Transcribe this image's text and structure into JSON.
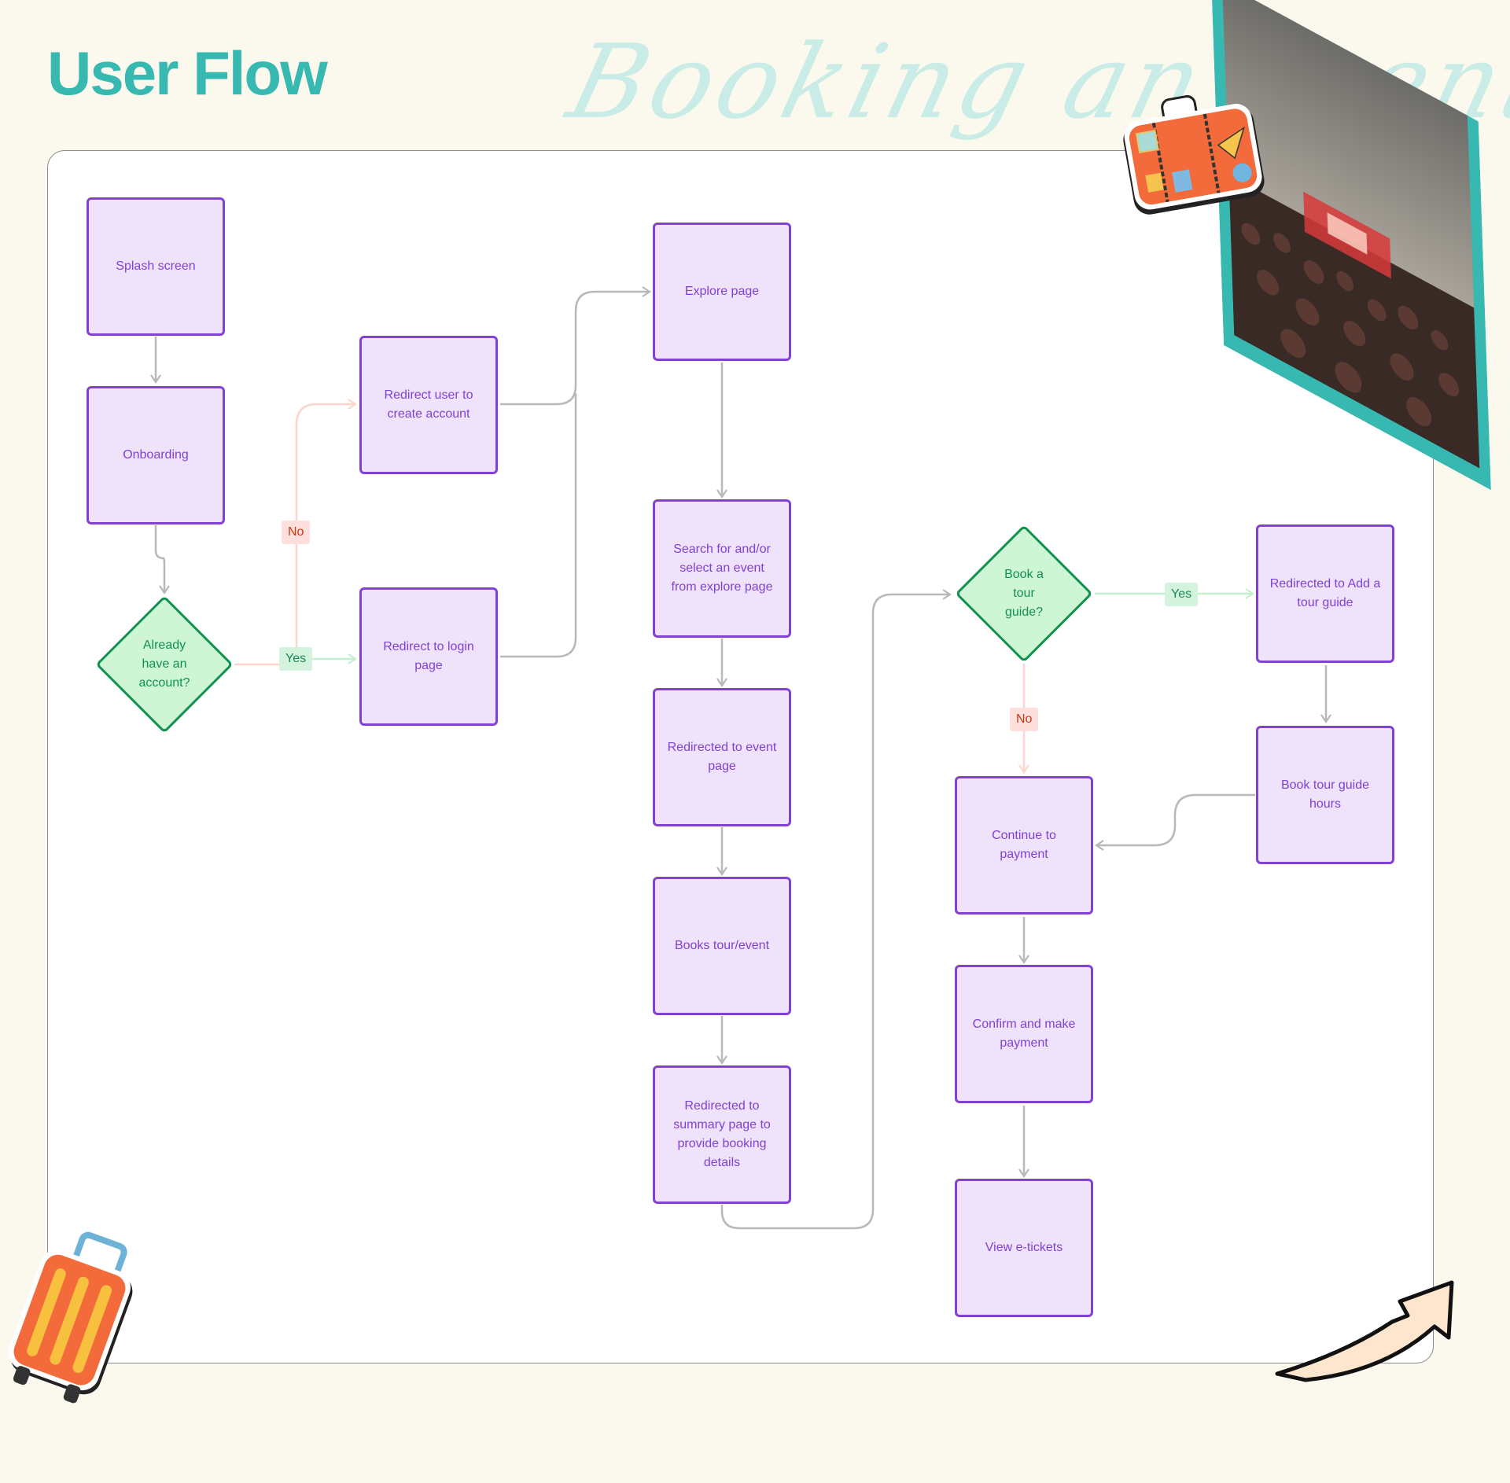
{
  "header": {
    "title": "User Flow",
    "script_subtitle": "Booking an event"
  },
  "colors": {
    "title": "#37b8b0",
    "process_fill": "#efe3fc",
    "process_border": "#8140d6",
    "decision_fill": "#cdf5d6",
    "decision_border": "#10924e",
    "connector": "#b8b8b8",
    "yes_badge": "#d3f3dc",
    "no_badge": "#fde0dc"
  },
  "nodes": {
    "splash": "Splash screen",
    "onboarding": "Onboarding",
    "create_account": "Redirect user to create account",
    "login": "Redirect to login page",
    "explore": "Explore page",
    "search": "Search for and/or select an event from explore page",
    "event_page": "Redirected to event page",
    "books": "Books tour/event",
    "summary": "Redirected to summary page to provide booking details",
    "add_guide": "Redirected to Add a tour guide",
    "guide_hours": "Book tour guide hours",
    "continue_payment": "Continue to payment",
    "confirm_payment": "Confirm and make payment",
    "etickets": "View e-tickets"
  },
  "decisions": {
    "has_account": "Already have an account?",
    "tour_guide": "Book a tour guide?"
  },
  "labels": {
    "yes": "Yes",
    "no": "No"
  },
  "edges": [
    {
      "from": "splash",
      "to": "onboarding"
    },
    {
      "from": "onboarding",
      "to": "has_account"
    },
    {
      "from": "has_account",
      "to": "login",
      "label": "Yes"
    },
    {
      "from": "has_account",
      "to": "create_account",
      "label": "No"
    },
    {
      "from": "create_account",
      "to": "explore"
    },
    {
      "from": "login",
      "to": "explore"
    },
    {
      "from": "explore",
      "to": "search"
    },
    {
      "from": "search",
      "to": "event_page"
    },
    {
      "from": "event_page",
      "to": "books"
    },
    {
      "from": "books",
      "to": "summary"
    },
    {
      "from": "summary",
      "to": "tour_guide"
    },
    {
      "from": "tour_guide",
      "to": "add_guide",
      "label": "Yes"
    },
    {
      "from": "tour_guide",
      "to": "continue_payment",
      "label": "No"
    },
    {
      "from": "add_guide",
      "to": "guide_hours"
    },
    {
      "from": "guide_hours",
      "to": "continue_payment"
    },
    {
      "from": "continue_payment",
      "to": "confirm_payment"
    },
    {
      "from": "confirm_payment",
      "to": "etickets"
    }
  ],
  "decorations": {
    "suitcase_sticker": "suitcase-sticker",
    "concert_photo": "concert-photo",
    "rolling_luggage": "rolling-luggage-sticker",
    "curved_arrow": "curved-arrow-sticker"
  }
}
